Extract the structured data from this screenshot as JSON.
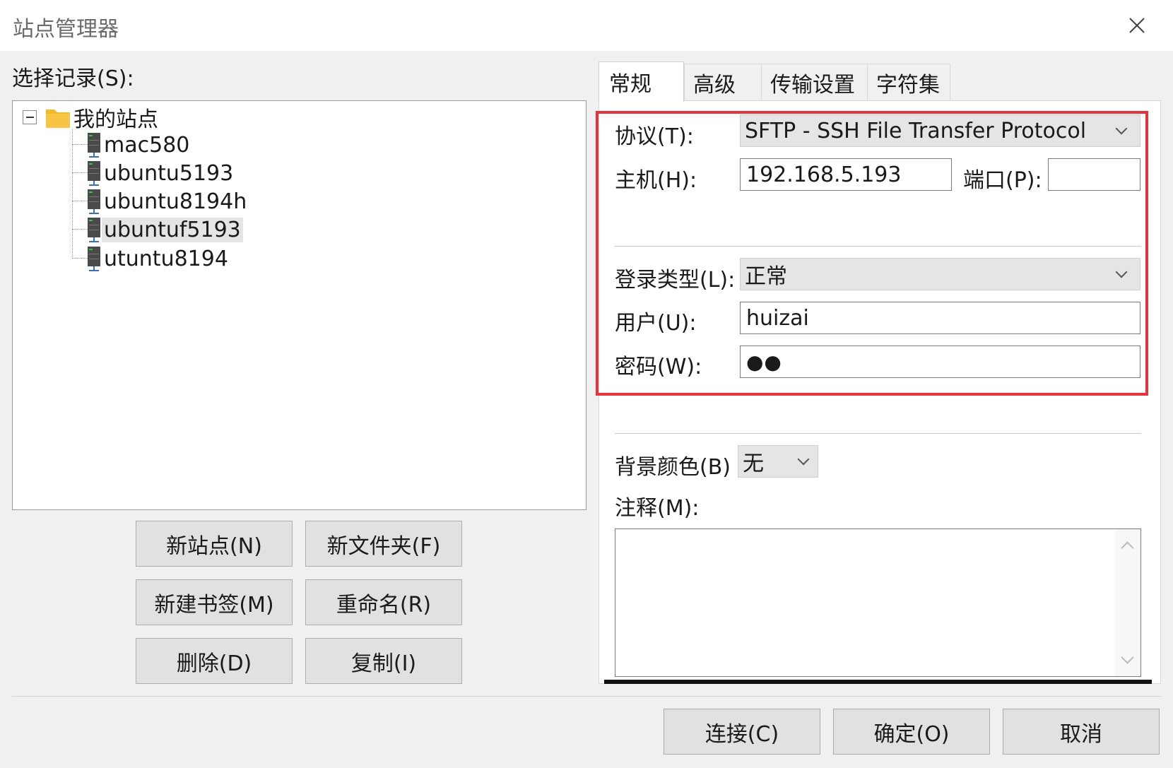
{
  "window": {
    "title": "站点管理器",
    "close_glyph": "✕"
  },
  "left": {
    "select_label": "选择记录(S):",
    "tree": {
      "root": "我的站点",
      "items": [
        "mac580",
        "ubuntu5193",
        "ubuntu8194h",
        "ubuntuf5193",
        "utuntu8194"
      ],
      "selected": "ubuntuf5193"
    },
    "buttons": {
      "new_site": "新站点(N)",
      "new_folder": "新文件夹(F)",
      "new_bookmark": "新建书签(M)",
      "rename": "重命名(R)",
      "delete": "删除(D)",
      "copy": "复制(I)"
    }
  },
  "tabs": [
    {
      "label": "常规",
      "active": true
    },
    {
      "label": "高级",
      "active": false
    },
    {
      "label": "传输设置",
      "active": false
    },
    {
      "label": "字符集",
      "active": false
    }
  ],
  "general": {
    "protocol_label": "协议(T):",
    "protocol_value": "SFTP - SSH File Transfer Protocol",
    "host_label": "主机(H):",
    "host_value": "192.168.5.193",
    "port_label": "端口(P):",
    "port_value": "",
    "logon_type_label": "登录类型(L):",
    "logon_type_value": "正常",
    "user_label": "用户(U):",
    "user_value": "huizai",
    "password_label": "密码(W):",
    "password_mask": "●●",
    "bgcolor_label": "背景颜色(B)",
    "bgcolor_value": "无",
    "notes_label": "注释(M):",
    "notes_value": ""
  },
  "footer": {
    "connect": "连接(C)",
    "ok": "确定(O)",
    "cancel": "取消"
  },
  "colors": {
    "highlight_border": "#e6323c",
    "folder": "#f5b82a",
    "server_icon": "#4a4a4a",
    "server_led": "#3fbf3f"
  },
  "icons": [
    "close-icon",
    "folder-icon",
    "server-icon",
    "chevron-down-icon",
    "scroll-up-icon",
    "scroll-down-icon"
  ]
}
